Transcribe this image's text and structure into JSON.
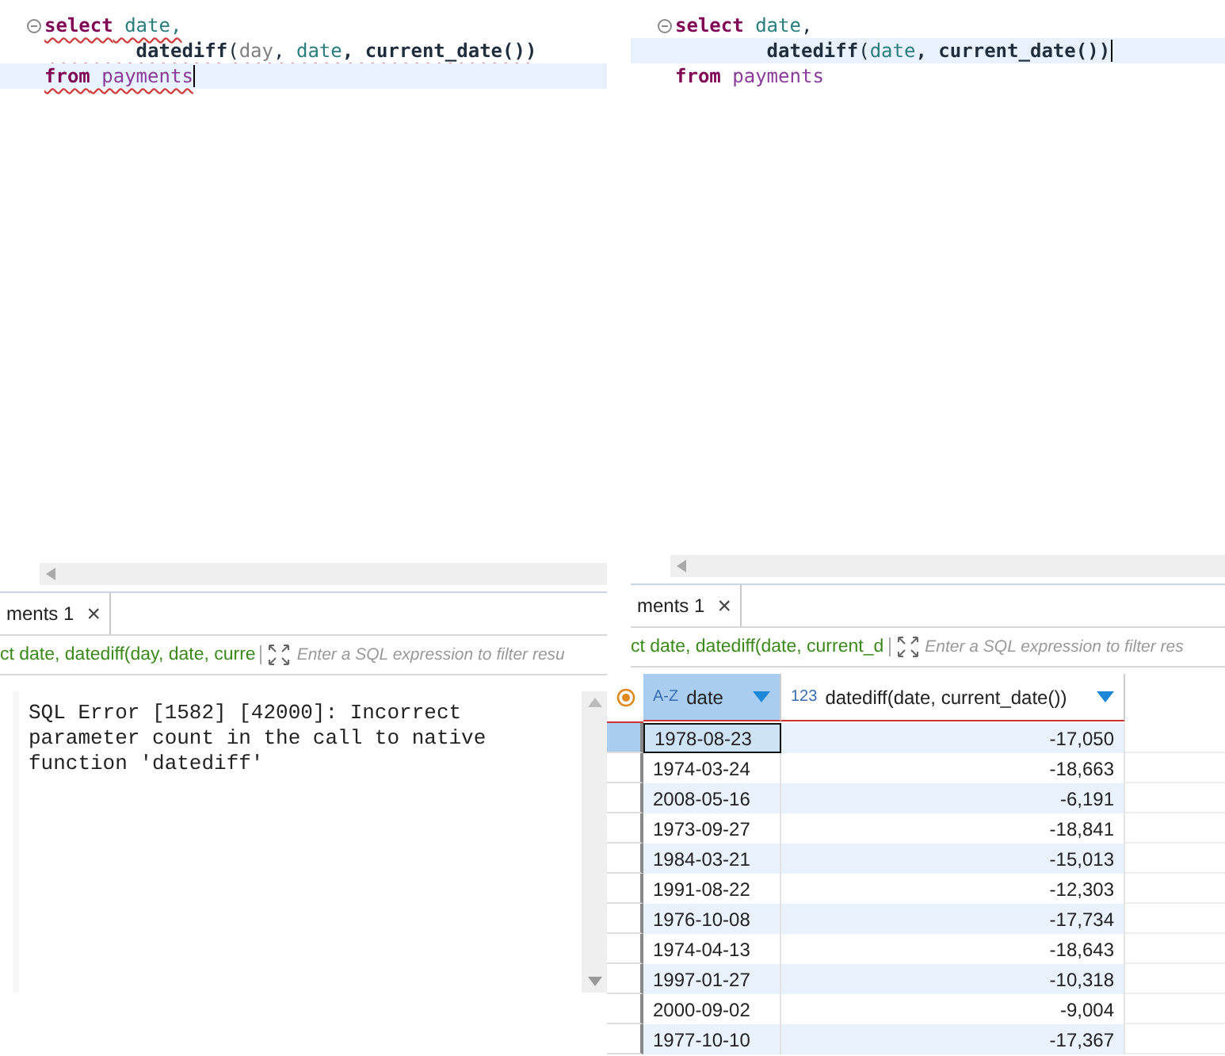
{
  "panels": [
    {
      "kind": "error",
      "squiggle": true,
      "lines": [
        {
          "current": false,
          "fold": true,
          "tokens": [
            {
              "text": "select",
              "kind": "keyword"
            },
            {
              "text": " date,",
              "kind": "column"
            }
          ]
        },
        {
          "current": false,
          "fold": false,
          "tokens": [
            {
              "text": "        datediff",
              "kind": "function"
            },
            {
              "text": "(",
              "kind": "plain"
            },
            {
              "text": "day",
              "kind": "muted"
            },
            {
              "text": ", ",
              "kind": "plain"
            },
            {
              "text": "date",
              "kind": "column"
            },
            {
              "text": ", current_date())",
              "kind": "function"
            }
          ]
        },
        {
          "current": true,
          "fold": false,
          "tokens": [
            {
              "text": "from",
              "kind": "keyword"
            },
            {
              "text": " payments",
              "kind": "table"
            }
          ]
        }
      ],
      "tab": "ments 1",
      "close": "×",
      "query": "ct date, datediff(day, date, curre",
      "filter_placeholder": "Enter a SQL expression to filter resu",
      "error": "SQL Error [1582] [42000]: Incorrect parameter count in the call to native function 'datediff'"
    },
    {
      "kind": "table",
      "squiggle": false,
      "lines": [
        {
          "current": false,
          "fold": true,
          "tokens": [
            {
              "text": "select",
              "kind": "keyword"
            },
            {
              "text": " date",
              "kind": "column"
            },
            {
              "text": ",",
              "kind": "plain"
            }
          ]
        },
        {
          "current": true,
          "fold": false,
          "tokens": [
            {
              "text": "        datediff",
              "kind": "function"
            },
            {
              "text": "(",
              "kind": "plain"
            },
            {
              "text": "date",
              "kind": "column"
            },
            {
              "text": ", current_date())",
              "kind": "function"
            }
          ]
        },
        {
          "current": false,
          "fold": false,
          "tokens": [
            {
              "text": "from",
              "kind": "keyword"
            },
            {
              "text": " payments",
              "kind": "table"
            }
          ]
        }
      ],
      "tab": "ments 1",
      "close": "×",
      "query": "ct date, datediff(date, current_d",
      "filter_placeholder": "Enter a SQL expression to filter res",
      "columns": [
        {
          "type": "A-Z",
          "label": "date"
        },
        {
          "type": "123",
          "label": "datediff(date, current_date())"
        }
      ],
      "rows": [
        {
          "selected": true,
          "cells": [
            "1978-08-23",
            "-17,050"
          ]
        },
        {
          "selected": false,
          "cells": [
            "1974-03-24",
            "-18,663"
          ]
        },
        {
          "selected": false,
          "cells": [
            "2008-05-16",
            "-6,191"
          ]
        },
        {
          "selected": false,
          "cells": [
            "1973-09-27",
            "-18,841"
          ]
        },
        {
          "selected": false,
          "cells": [
            "1984-03-21",
            "-15,013"
          ]
        },
        {
          "selected": false,
          "cells": [
            "1991-08-22",
            "-12,303"
          ]
        },
        {
          "selected": false,
          "cells": [
            "1976-10-08",
            "-17,734"
          ]
        },
        {
          "selected": false,
          "cells": [
            "1974-04-13",
            "-18,643"
          ]
        },
        {
          "selected": false,
          "cells": [
            "1997-01-27",
            "-10,318"
          ]
        },
        {
          "selected": false,
          "cells": [
            "2000-09-02",
            "-9,004"
          ]
        },
        {
          "selected": false,
          "cells": [
            "1977-10-10",
            "-17,367"
          ]
        }
      ]
    }
  ]
}
